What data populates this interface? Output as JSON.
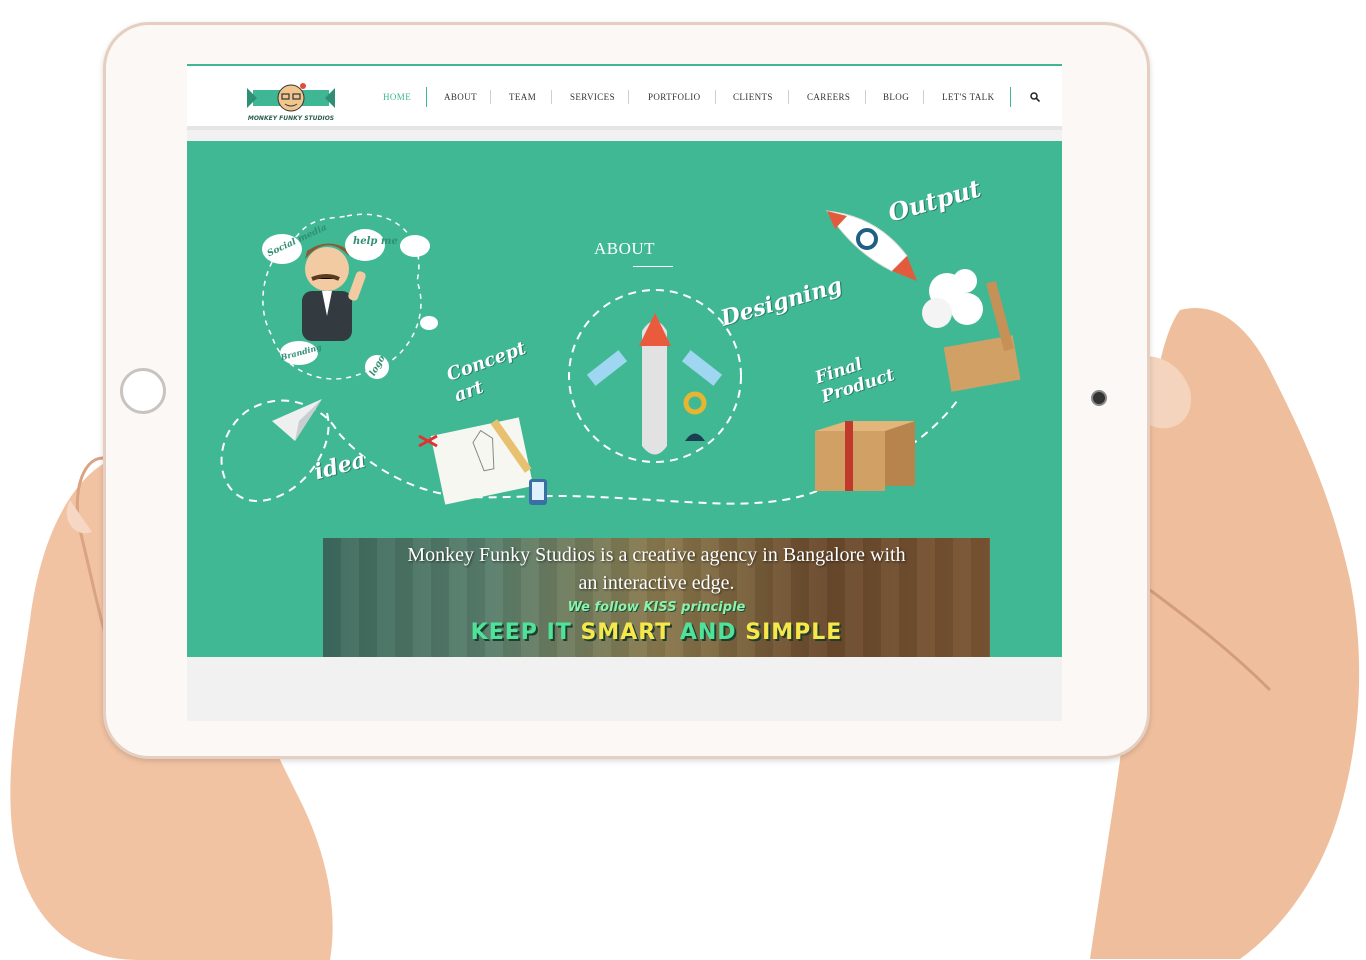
{
  "nav": {
    "items": [
      {
        "label": "HOME",
        "active": true
      },
      {
        "label": "ABOUT"
      },
      {
        "label": "TEAM"
      },
      {
        "label": "SERVICES"
      },
      {
        "label": "PORTFOLIO"
      },
      {
        "label": "CLIENTS"
      },
      {
        "label": "CAREERS"
      },
      {
        "label": "BLOG"
      },
      {
        "label": "LET'S TALK"
      }
    ],
    "search_icon": "search-icon"
  },
  "logo": {
    "text": "MONKEY FUNKY STUDIOS"
  },
  "hero": {
    "title": "ABOUT",
    "labels": {
      "idea": "idea",
      "concept": "Concept art",
      "designing": "Designing",
      "final": "Final Product",
      "output": "Output",
      "social": "Social media",
      "help": "help me",
      "branding": "Branding",
      "logo": "logo"
    }
  },
  "banner": {
    "line1": "Monkey Funky Studios is a creative agency in Bangalore with",
    "line2": "an  interactive edge.",
    "kiss_small": "We follow KISS principle",
    "kiss_words": [
      "KEEP",
      "IT",
      "SMART",
      "AND",
      "SIMPLE"
    ]
  },
  "colors": {
    "accent": "#41b894",
    "nav_active": "#40b794",
    "nav_text": "#333333"
  }
}
